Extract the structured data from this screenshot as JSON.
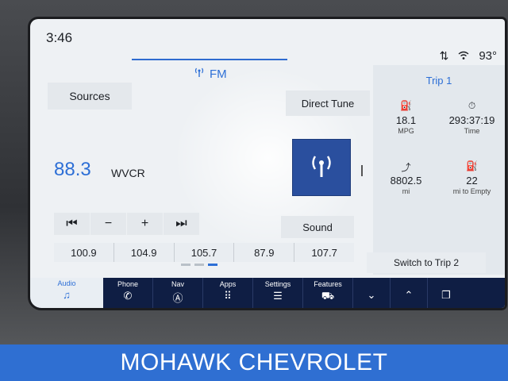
{
  "status": {
    "time": "3:46",
    "temperature": "93°"
  },
  "radio": {
    "band_tab": "FM",
    "sources_label": "Sources",
    "direct_tune_label": "Direct Tune",
    "frequency": "88.3",
    "station": "WVCR",
    "sound_label": "Sound",
    "presets": [
      "100.9",
      "104.9",
      "105.7",
      "87.9",
      "107.7"
    ]
  },
  "trip": {
    "title": "Trip 1",
    "stats": [
      {
        "icon": "fuel-icon",
        "value": "18.1",
        "label": "MPG"
      },
      {
        "icon": "stopwatch-icon",
        "value": "293:37:19",
        "label": "Time"
      },
      {
        "icon": "route-icon",
        "value": "8802.5",
        "label": "mi"
      },
      {
        "icon": "fuel-pump-icon",
        "value": "22",
        "label": "mi to Empty"
      }
    ],
    "switch_label": "Switch to Trip 2"
  },
  "nav": {
    "items": [
      {
        "label": "Audio",
        "icon": "music-note-icon"
      },
      {
        "label": "Phone",
        "icon": "phone-icon"
      },
      {
        "label": "Nav",
        "icon": "navigation-icon"
      },
      {
        "label": "Apps",
        "icon": "apps-grid-icon"
      },
      {
        "label": "Settings",
        "icon": "sliders-icon"
      },
      {
        "label": "Features",
        "icon": "truck-icon"
      }
    ]
  },
  "banner": {
    "text": "MOHAWK CHEVROLET"
  },
  "colors": {
    "accent": "#2d6fd6",
    "navbar": "#0f1e44",
    "banner": "#2f6fd2",
    "station_art": "#2a4f9e"
  }
}
